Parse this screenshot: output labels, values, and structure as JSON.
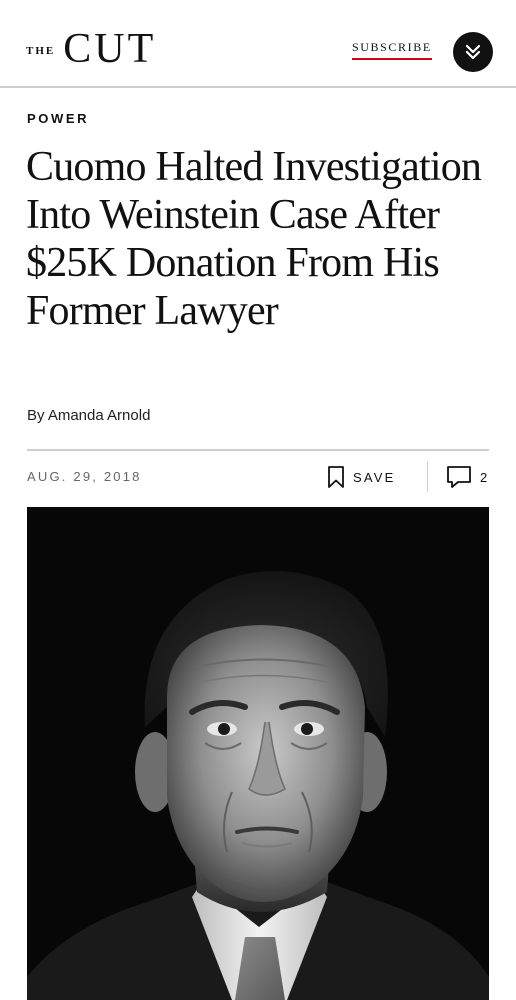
{
  "header": {
    "logo_the": "THE",
    "logo_cut": "CUT",
    "subscribe_label": "SUBSCRIBE",
    "menu_icon": "double-chevron-down-icon"
  },
  "article": {
    "kicker": "POWER",
    "headline": "Cuomo Halted Investigation Into Weinstein Case After $25K Donation From His Former Lawyer",
    "byline": "By Amanda Arnold",
    "date": "AUG. 29, 2018",
    "save_label": "SAVE",
    "save_icon": "bookmark-icon",
    "comment_icon": "comment-bubble-icon",
    "comment_count": "2"
  },
  "lead_image": {
    "style": "black-and-white portrait photograph"
  },
  "colors": {
    "text": "#111111",
    "muted": "#666666",
    "rule": "#cfcfcf",
    "accent": "#d0021b",
    "menu_bg": "#111111"
  }
}
